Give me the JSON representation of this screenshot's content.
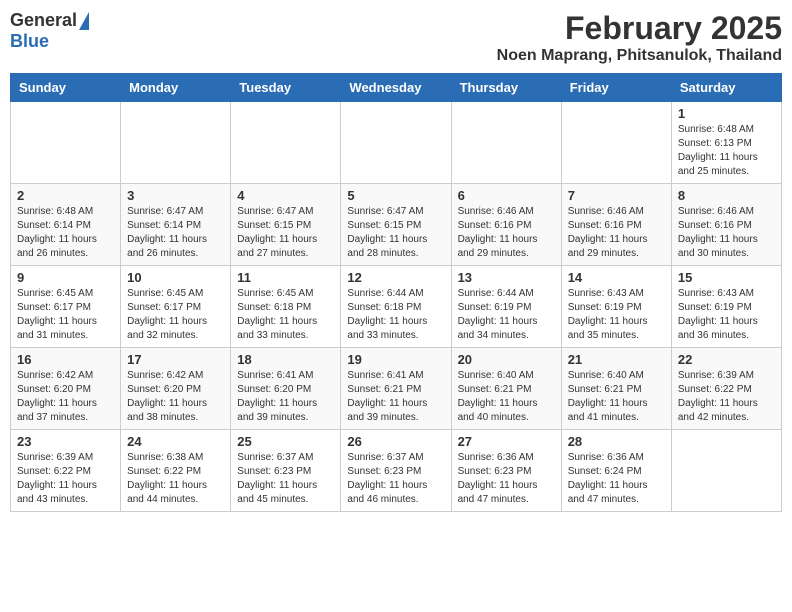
{
  "logo": {
    "general": "General",
    "blue": "Blue"
  },
  "title": "February 2025",
  "subtitle": "Noen Maprang, Phitsanulok, Thailand",
  "days_of_week": [
    "Sunday",
    "Monday",
    "Tuesday",
    "Wednesday",
    "Thursday",
    "Friday",
    "Saturday"
  ],
  "weeks": [
    [
      {
        "day": "",
        "info": ""
      },
      {
        "day": "",
        "info": ""
      },
      {
        "day": "",
        "info": ""
      },
      {
        "day": "",
        "info": ""
      },
      {
        "day": "",
        "info": ""
      },
      {
        "day": "",
        "info": ""
      },
      {
        "day": "1",
        "info": "Sunrise: 6:48 AM\nSunset: 6:13 PM\nDaylight: 11 hours\nand 25 minutes."
      }
    ],
    [
      {
        "day": "2",
        "info": "Sunrise: 6:48 AM\nSunset: 6:14 PM\nDaylight: 11 hours\nand 26 minutes."
      },
      {
        "day": "3",
        "info": "Sunrise: 6:47 AM\nSunset: 6:14 PM\nDaylight: 11 hours\nand 26 minutes."
      },
      {
        "day": "4",
        "info": "Sunrise: 6:47 AM\nSunset: 6:15 PM\nDaylight: 11 hours\nand 27 minutes."
      },
      {
        "day": "5",
        "info": "Sunrise: 6:47 AM\nSunset: 6:15 PM\nDaylight: 11 hours\nand 28 minutes."
      },
      {
        "day": "6",
        "info": "Sunrise: 6:46 AM\nSunset: 6:16 PM\nDaylight: 11 hours\nand 29 minutes."
      },
      {
        "day": "7",
        "info": "Sunrise: 6:46 AM\nSunset: 6:16 PM\nDaylight: 11 hours\nand 29 minutes."
      },
      {
        "day": "8",
        "info": "Sunrise: 6:46 AM\nSunset: 6:16 PM\nDaylight: 11 hours\nand 30 minutes."
      }
    ],
    [
      {
        "day": "9",
        "info": "Sunrise: 6:45 AM\nSunset: 6:17 PM\nDaylight: 11 hours\nand 31 minutes."
      },
      {
        "day": "10",
        "info": "Sunrise: 6:45 AM\nSunset: 6:17 PM\nDaylight: 11 hours\nand 32 minutes."
      },
      {
        "day": "11",
        "info": "Sunrise: 6:45 AM\nSunset: 6:18 PM\nDaylight: 11 hours\nand 33 minutes."
      },
      {
        "day": "12",
        "info": "Sunrise: 6:44 AM\nSunset: 6:18 PM\nDaylight: 11 hours\nand 33 minutes."
      },
      {
        "day": "13",
        "info": "Sunrise: 6:44 AM\nSunset: 6:19 PM\nDaylight: 11 hours\nand 34 minutes."
      },
      {
        "day": "14",
        "info": "Sunrise: 6:43 AM\nSunset: 6:19 PM\nDaylight: 11 hours\nand 35 minutes."
      },
      {
        "day": "15",
        "info": "Sunrise: 6:43 AM\nSunset: 6:19 PM\nDaylight: 11 hours\nand 36 minutes."
      }
    ],
    [
      {
        "day": "16",
        "info": "Sunrise: 6:42 AM\nSunset: 6:20 PM\nDaylight: 11 hours\nand 37 minutes."
      },
      {
        "day": "17",
        "info": "Sunrise: 6:42 AM\nSunset: 6:20 PM\nDaylight: 11 hours\nand 38 minutes."
      },
      {
        "day": "18",
        "info": "Sunrise: 6:41 AM\nSunset: 6:20 PM\nDaylight: 11 hours\nand 39 minutes."
      },
      {
        "day": "19",
        "info": "Sunrise: 6:41 AM\nSunset: 6:21 PM\nDaylight: 11 hours\nand 39 minutes."
      },
      {
        "day": "20",
        "info": "Sunrise: 6:40 AM\nSunset: 6:21 PM\nDaylight: 11 hours\nand 40 minutes."
      },
      {
        "day": "21",
        "info": "Sunrise: 6:40 AM\nSunset: 6:21 PM\nDaylight: 11 hours\nand 41 minutes."
      },
      {
        "day": "22",
        "info": "Sunrise: 6:39 AM\nSunset: 6:22 PM\nDaylight: 11 hours\nand 42 minutes."
      }
    ],
    [
      {
        "day": "23",
        "info": "Sunrise: 6:39 AM\nSunset: 6:22 PM\nDaylight: 11 hours\nand 43 minutes."
      },
      {
        "day": "24",
        "info": "Sunrise: 6:38 AM\nSunset: 6:22 PM\nDaylight: 11 hours\nand 44 minutes."
      },
      {
        "day": "25",
        "info": "Sunrise: 6:37 AM\nSunset: 6:23 PM\nDaylight: 11 hours\nand 45 minutes."
      },
      {
        "day": "26",
        "info": "Sunrise: 6:37 AM\nSunset: 6:23 PM\nDaylight: 11 hours\nand 46 minutes."
      },
      {
        "day": "27",
        "info": "Sunrise: 6:36 AM\nSunset: 6:23 PM\nDaylight: 11 hours\nand 47 minutes."
      },
      {
        "day": "28",
        "info": "Sunrise: 6:36 AM\nSunset: 6:24 PM\nDaylight: 11 hours\nand 47 minutes."
      },
      {
        "day": "",
        "info": ""
      }
    ]
  ]
}
